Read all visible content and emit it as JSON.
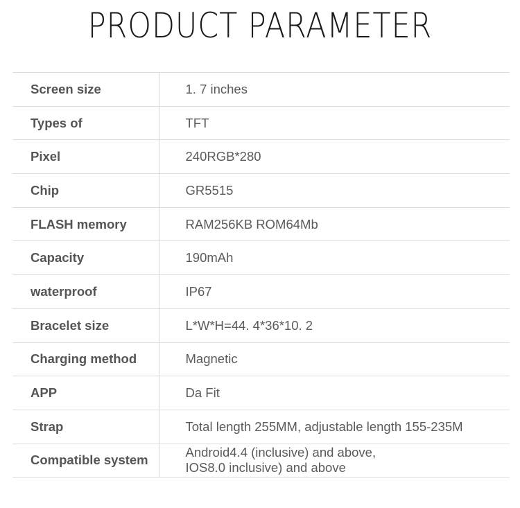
{
  "title": "PRODUCT PARAMETER",
  "parameters": [
    {
      "label": "Screen size",
      "value": [
        "1. 7 inches"
      ]
    },
    {
      "label": "Types of",
      "value": [
        "TFT"
      ]
    },
    {
      "label": "Pixel",
      "value": [
        "240RGB*280"
      ]
    },
    {
      "label": "Chip",
      "value": [
        "GR5515"
      ]
    },
    {
      "label": "FLASH memory",
      "value": [
        "RAM256KB ROM64Mb"
      ]
    },
    {
      "label": "Capacity",
      "value": [
        "190mAh"
      ]
    },
    {
      "label": "waterproof",
      "value": [
        "IP67"
      ]
    },
    {
      "label": "Bracelet size",
      "value": [
        "L*W*H=44. 4*36*10. 2"
      ]
    },
    {
      "label": "Charging method",
      "value": [
        "Magnetic"
      ]
    },
    {
      "label": "APP",
      "value": [
        "Da Fit"
      ]
    },
    {
      "label": "Strap",
      "value": [
        "Total length 255MM, adjustable length 155-235M"
      ]
    },
    {
      "label": "Compatible system",
      "value": [
        "Android4.4 (inclusive) and above,",
        "IOS8.0 inclusive) and above"
      ]
    }
  ]
}
